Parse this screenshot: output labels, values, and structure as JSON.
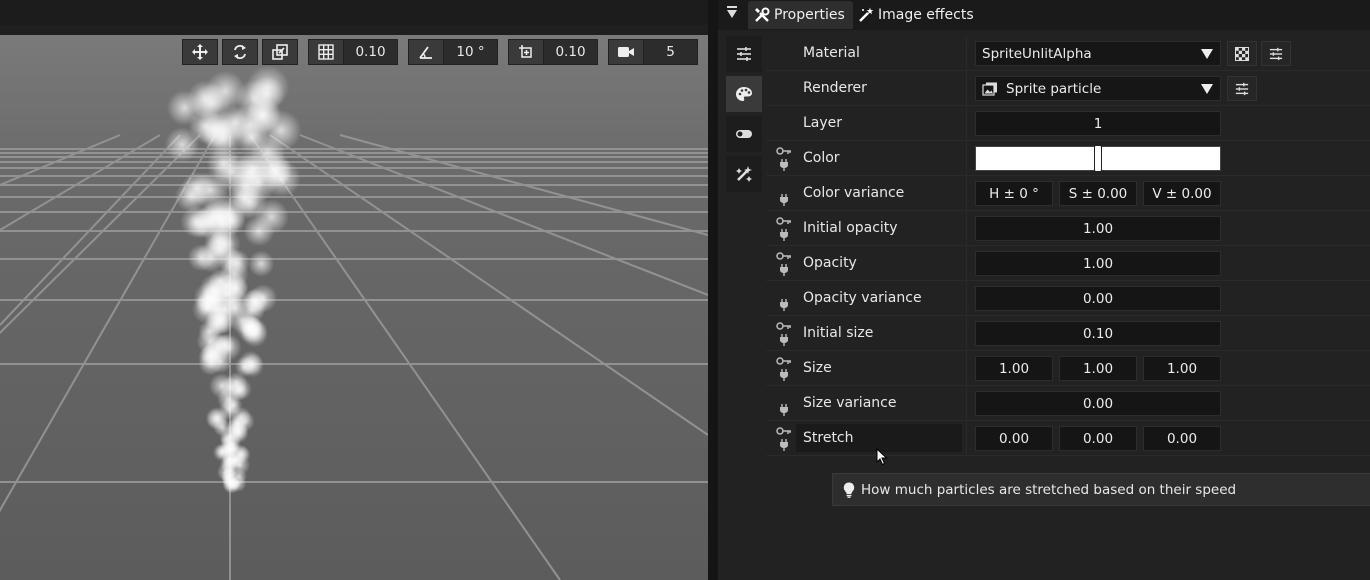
{
  "viewport": {
    "toolbar": {
      "grid_value": "0.10",
      "angle_value": "10 °",
      "scale_value": "0.10",
      "camera_value": "5"
    }
  },
  "tabs": {
    "properties": "Properties",
    "image_effects": "Image effects"
  },
  "properties": {
    "material": {
      "label": "Material",
      "value": "SpriteUnlitAlpha"
    },
    "renderer": {
      "label": "Renderer",
      "value": "Sprite particle"
    },
    "layer": {
      "label": "Layer",
      "value": "1"
    },
    "color": {
      "label": "Color",
      "value_hex": "#ffffff"
    },
    "color_variance": {
      "label": "Color variance",
      "h": "H ± 0 °",
      "s": "S ± 0.00",
      "v": "V ± 0.00"
    },
    "initial_opacity": {
      "label": "Initial opacity",
      "value": "1.00"
    },
    "opacity": {
      "label": "Opacity",
      "value": "1.00"
    },
    "opacity_variance": {
      "label": "Opacity variance",
      "value": "0.00"
    },
    "initial_size": {
      "label": "Initial size",
      "value": "0.10"
    },
    "size": {
      "label": "Size",
      "x": "1.00",
      "y": "1.00",
      "z": "1.00"
    },
    "size_variance": {
      "label": "Size variance",
      "value": "0.00"
    },
    "stretch": {
      "label": "Stretch",
      "x": "0.00",
      "y": "0.00",
      "z": "0.00"
    }
  },
  "tooltip": {
    "text": "How much particles are stretched based on their speed"
  },
  "colors": {
    "panel_bg": "#222222",
    "field_bg": "#151515",
    "viewport_bg": "#666666"
  }
}
